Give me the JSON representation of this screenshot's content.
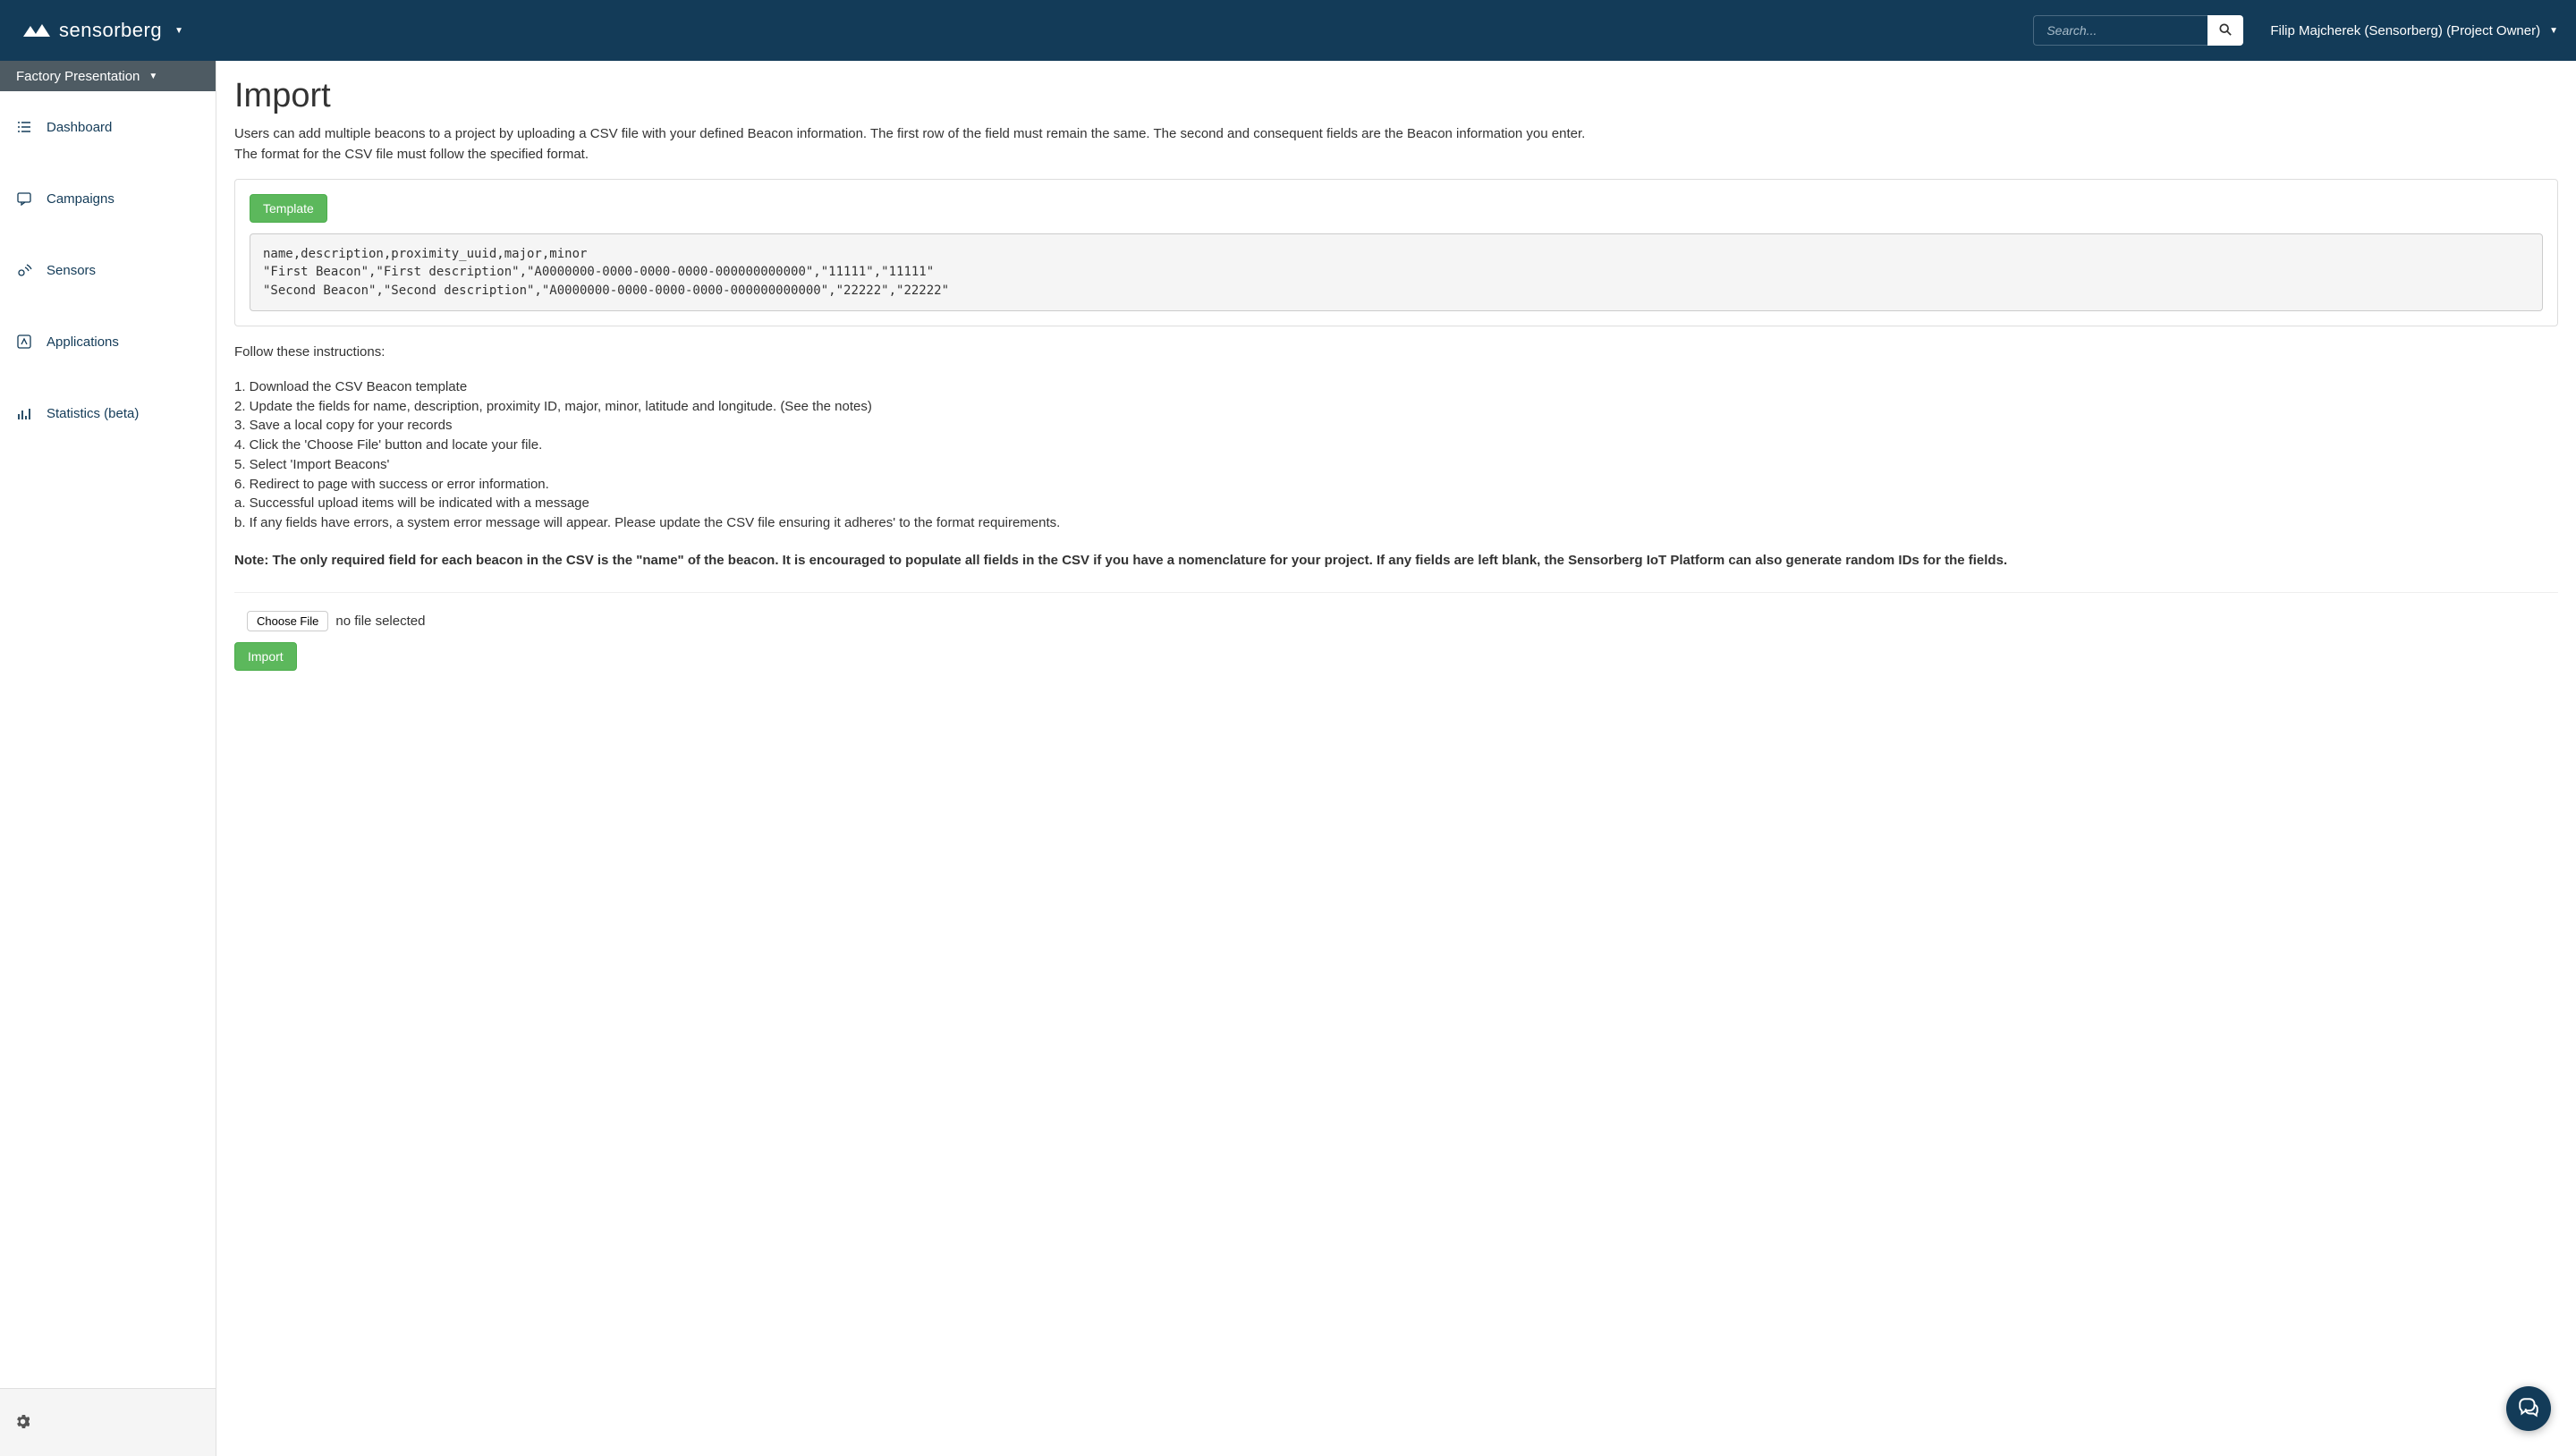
{
  "header": {
    "brand": "sensorberg",
    "search_placeholder": "Search...",
    "user_label": "Filip Majcherek (Sensorberg) (Project Owner)"
  },
  "sidebar": {
    "project_label": "Factory Presentation",
    "items": [
      {
        "label": "Dashboard"
      },
      {
        "label": "Campaigns"
      },
      {
        "label": "Sensors"
      },
      {
        "label": "Applications"
      },
      {
        "label": "Statistics (beta)"
      }
    ]
  },
  "main": {
    "title": "Import",
    "intro_line1": "Users can add multiple beacons to a project by uploading a CSV file with your defined Beacon information. The first row of the field must remain the same. The second and consequent fields are the Beacon information you enter.",
    "intro_line2": "The format for the CSV file must follow the specified format.",
    "template_button": "Template",
    "csv_example": "name,description,proximity_uuid,major,minor\n\"First Beacon\",\"First description\",\"A0000000-0000-0000-0000-000000000000\",\"11111\",\"11111\"\n\"Second Beacon\",\"Second description\",\"A0000000-0000-0000-0000-000000000000\",\"22222\",\"22222\"",
    "instructions_title": "Follow these instructions:",
    "steps": "1. Download the CSV Beacon template\n2. Update the fields for name, description, proximity ID, major, minor, latitude and longitude. (See the notes)\n3. Save a local copy for your records\n4. Click the 'Choose File' button and locate your file.\n5. Select 'Import Beacons'\n6. Redirect to page with success or error information.\na. Successful upload items will be indicated with a message\nb. If any fields have errors, a system error message will appear. Please update the CSV file ensuring it adheres' to the format requirements.",
    "note": "Note: The only required field for each beacon in the CSV is the \"name\" of the beacon. It is encouraged to populate all fields in the CSV if you have a nomenclature for your project. If any fields are left blank, the Sensorberg IoT Platform can also generate random IDs for the fields.",
    "choose_file_label": "Choose File",
    "no_file_label": "no file selected",
    "import_button": "Import"
  }
}
